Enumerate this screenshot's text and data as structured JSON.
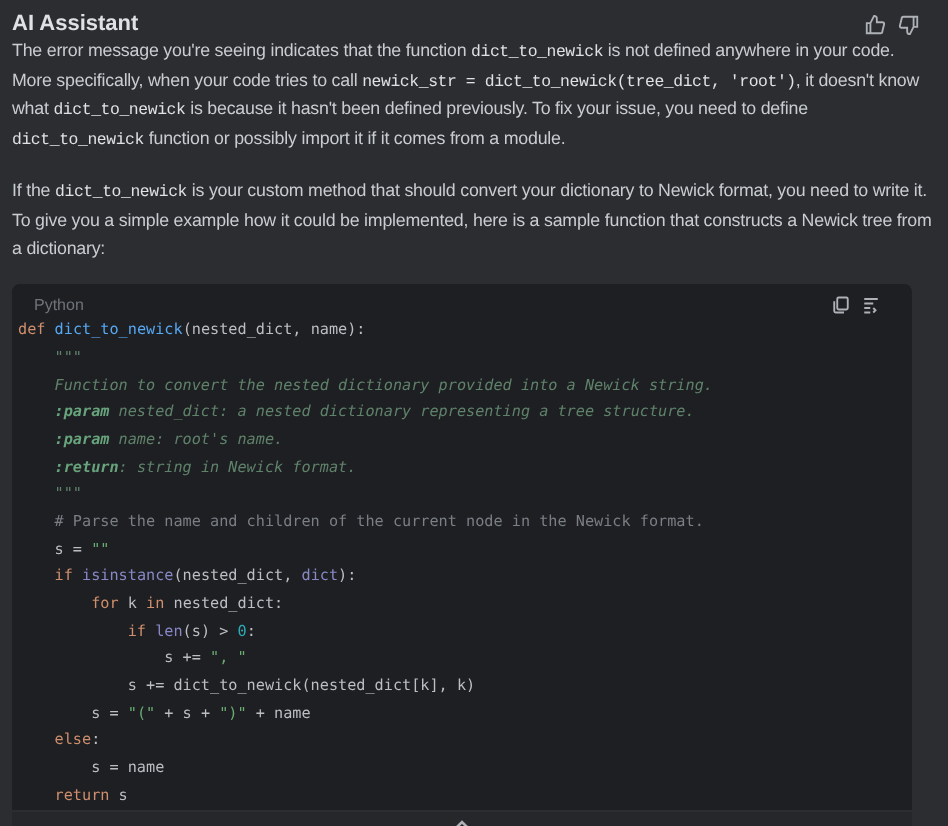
{
  "title": "AI Assistant",
  "paragraphs": [
    [
      {
        "kind": "text",
        "text": "The error message you're seeing indicates that the function "
      },
      {
        "kind": "code",
        "text": "dict_to_newick"
      },
      {
        "kind": "text",
        "text": " is not defined anywhere in your code. More specifically, when your code tries to call "
      },
      {
        "kind": "code",
        "text": "newick_str = dict_to_newick(tree_dict, 'root')"
      },
      {
        "kind": "text",
        "text": ", it doesn't know what "
      },
      {
        "kind": "code",
        "text": "dict_to_newick"
      },
      {
        "kind": "text",
        "text": " is because it hasn't been defined previously. To fix your issue, you need to define "
      },
      {
        "kind": "code",
        "text": "dict_to_newick"
      },
      {
        "kind": "text",
        "text": " function or possibly import it if it comes from a module."
      }
    ],
    [
      {
        "kind": "text",
        "text": "If the "
      },
      {
        "kind": "code",
        "text": "dict_to_newick"
      },
      {
        "kind": "text",
        "text": " is your custom method that should convert your dictionary to Newick format, you need to write it. To give you a simple example how it could be implemented, here is a sample function that constructs a Newick tree from a dictionary:"
      }
    ]
  ],
  "code_block": {
    "language": "Python",
    "lines": [
      [
        {
          "kind": "keyword",
          "text": "def "
        },
        {
          "kind": "func",
          "text": "dict_to_newick"
        },
        {
          "kind": "plain",
          "text": "(nested_dict, name):"
        }
      ],
      [
        {
          "kind": "doc",
          "text": "    \"\"\""
        }
      ],
      [
        {
          "kind": "doc",
          "text": "    Function to convert the nested dictionary provided into a Newick string."
        }
      ],
      [
        {
          "kind": "doctag",
          "text": "    :param"
        },
        {
          "kind": "doc",
          "text": " nested_dict: a nested dictionary representing a tree structure."
        }
      ],
      [
        {
          "kind": "doctag",
          "text": "    :param"
        },
        {
          "kind": "doc",
          "text": " name: root's name."
        }
      ],
      [
        {
          "kind": "doctag",
          "text": "    :return"
        },
        {
          "kind": "doc",
          "text": ": string in Newick format."
        }
      ],
      [
        {
          "kind": "doc",
          "text": "    \"\"\""
        }
      ],
      [
        {
          "kind": "comment",
          "text": "    # Parse the name and children of the current node in the Newick format."
        }
      ],
      [
        {
          "kind": "plain",
          "text": "    s = "
        },
        {
          "kind": "string",
          "text": "\"\""
        }
      ],
      [
        {
          "kind": "keyword",
          "text": "    if "
        },
        {
          "kind": "builtin",
          "text": "isinstance"
        },
        {
          "kind": "plain",
          "text": "(nested_dict, "
        },
        {
          "kind": "builtin",
          "text": "dict"
        },
        {
          "kind": "plain",
          "text": "):"
        }
      ],
      [
        {
          "kind": "keyword",
          "text": "        for "
        },
        {
          "kind": "plain",
          "text": "k "
        },
        {
          "kind": "keyword",
          "text": "in "
        },
        {
          "kind": "plain",
          "text": "nested_dict:"
        }
      ],
      [
        {
          "kind": "keyword",
          "text": "            if "
        },
        {
          "kind": "builtin",
          "text": "len"
        },
        {
          "kind": "plain",
          "text": "(s) > "
        },
        {
          "kind": "number",
          "text": "0"
        },
        {
          "kind": "plain",
          "text": ":"
        }
      ],
      [
        {
          "kind": "plain",
          "text": "                s += "
        },
        {
          "kind": "string",
          "text": "\", \""
        }
      ],
      [
        {
          "kind": "plain",
          "text": "            s += dict_to_newick(nested_dict[k], k)"
        }
      ],
      [
        {
          "kind": "plain",
          "text": "        s = "
        },
        {
          "kind": "string",
          "text": "\"(\""
        },
        {
          "kind": "plain",
          "text": " + s + "
        },
        {
          "kind": "string",
          "text": "\")\""
        },
        {
          "kind": "plain",
          "text": " + name"
        }
      ],
      [
        {
          "kind": "keyword",
          "text": "    else"
        },
        {
          "kind": "plain",
          "text": ":"
        }
      ],
      [
        {
          "kind": "plain",
          "text": "        s = name"
        }
      ],
      [
        {
          "kind": "keyword",
          "text": "    return "
        },
        {
          "kind": "plain",
          "text": "s"
        }
      ]
    ]
  }
}
